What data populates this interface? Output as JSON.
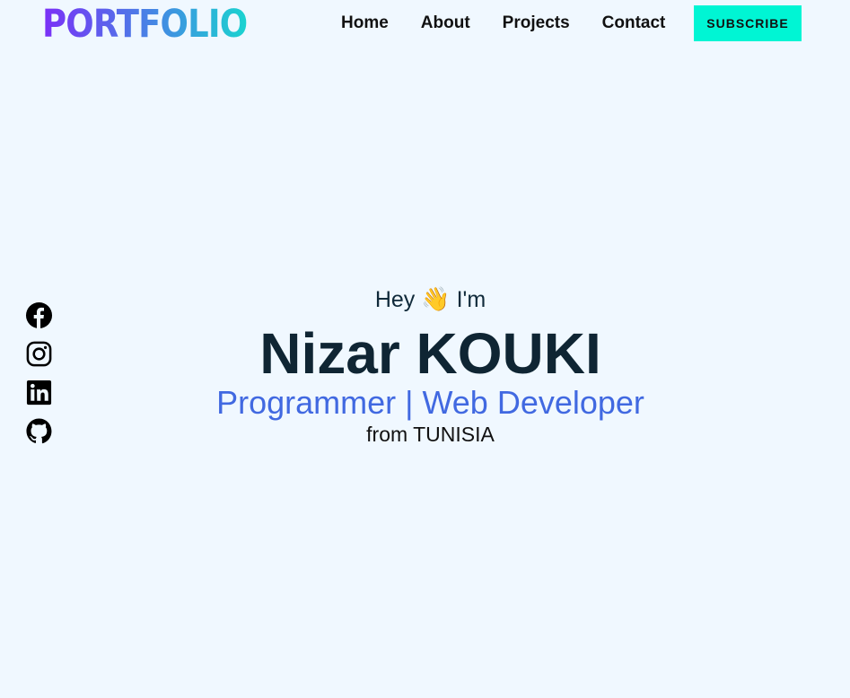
{
  "header": {
    "logo": "PORTFOLIO",
    "nav": [
      "Home",
      "About",
      "Projects",
      "Contact"
    ],
    "subscribe_label": "SUBSCRIBE"
  },
  "social": [
    {
      "name": "facebook-icon"
    },
    {
      "name": "instagram-icon"
    },
    {
      "name": "linkedin-icon"
    },
    {
      "name": "github-icon"
    }
  ],
  "hero": {
    "greeting_pre": "Hey",
    "greeting_emoji": "👋",
    "greeting_post": "I'm",
    "name": "Nizar KOUKI",
    "role": "Programmer | Web Developer",
    "origin": "from TUNISIA"
  },
  "colors": {
    "background": "#f0f8ff",
    "accent": "#00f5d4",
    "role_text": "#4169e1",
    "logo_gradient": [
      "#7b2ff7",
      "#4a7fe6",
      "#1ad3d0"
    ]
  }
}
